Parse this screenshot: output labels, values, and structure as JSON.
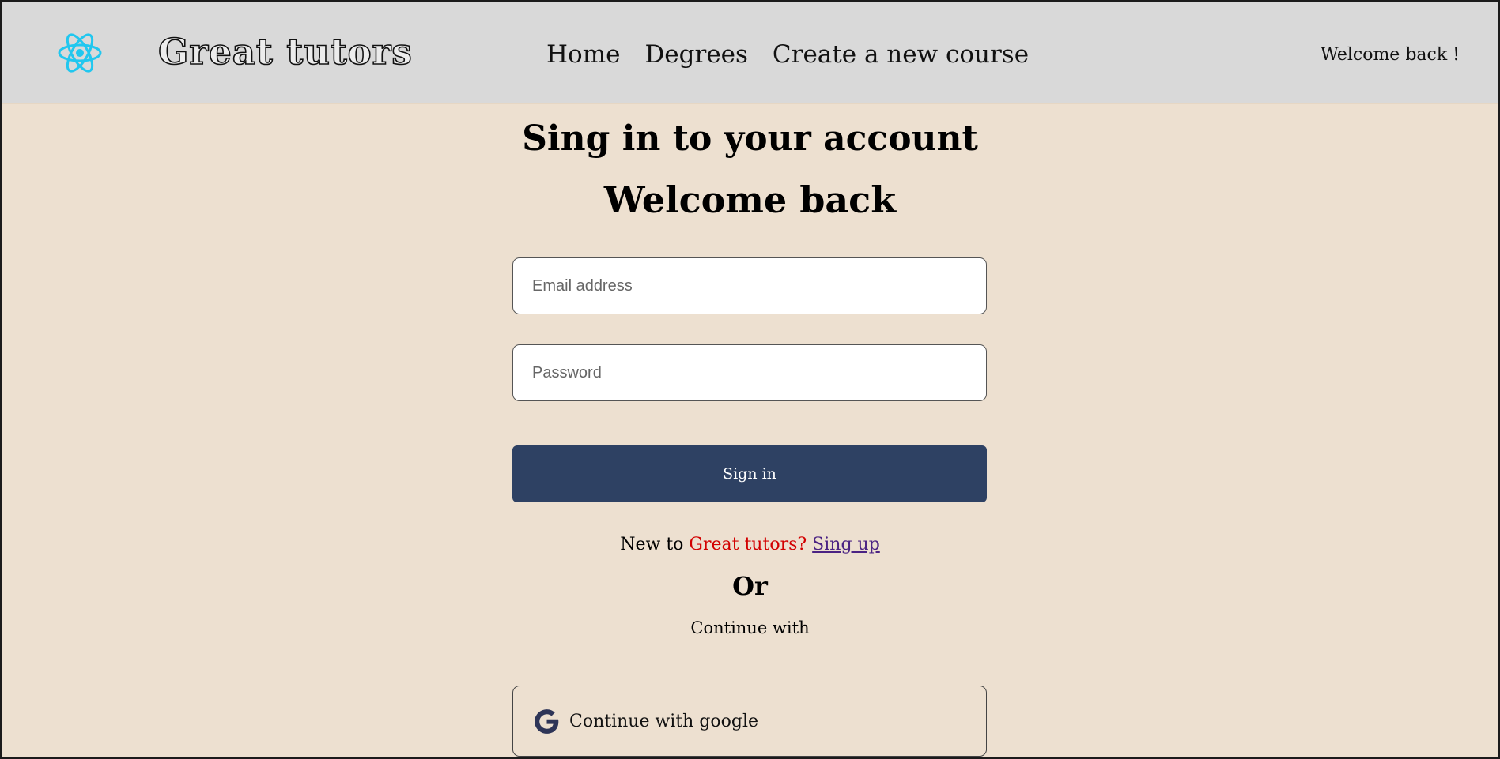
{
  "header": {
    "brand": "Great tutors",
    "nav": [
      {
        "label": "Home"
      },
      {
        "label": "Degrees"
      },
      {
        "label": "Create a new course"
      }
    ],
    "welcome": "Welcome back !"
  },
  "login": {
    "title": "Sing in to your account",
    "subtitle": "Welcome back",
    "email_placeholder": "Email address",
    "password_placeholder": "Password",
    "signin_label": "Sign in",
    "new_to_prefix": "New to ",
    "new_to_brand": "Great tutors?",
    "signup_label": "Sing up",
    "or_label": "Or",
    "continue_with": "Continue with",
    "google_label": "Continue with google"
  },
  "icons": {
    "logo": "react-atom-icon",
    "google": "google-g-icon"
  },
  "colors": {
    "background": "#ede0d0",
    "navbar": "#d9d9d9",
    "primary_button": "#2e4163",
    "brand_red": "#d20000",
    "link_purple": "#4b2383",
    "logo_cyan": "#21c7ef"
  }
}
